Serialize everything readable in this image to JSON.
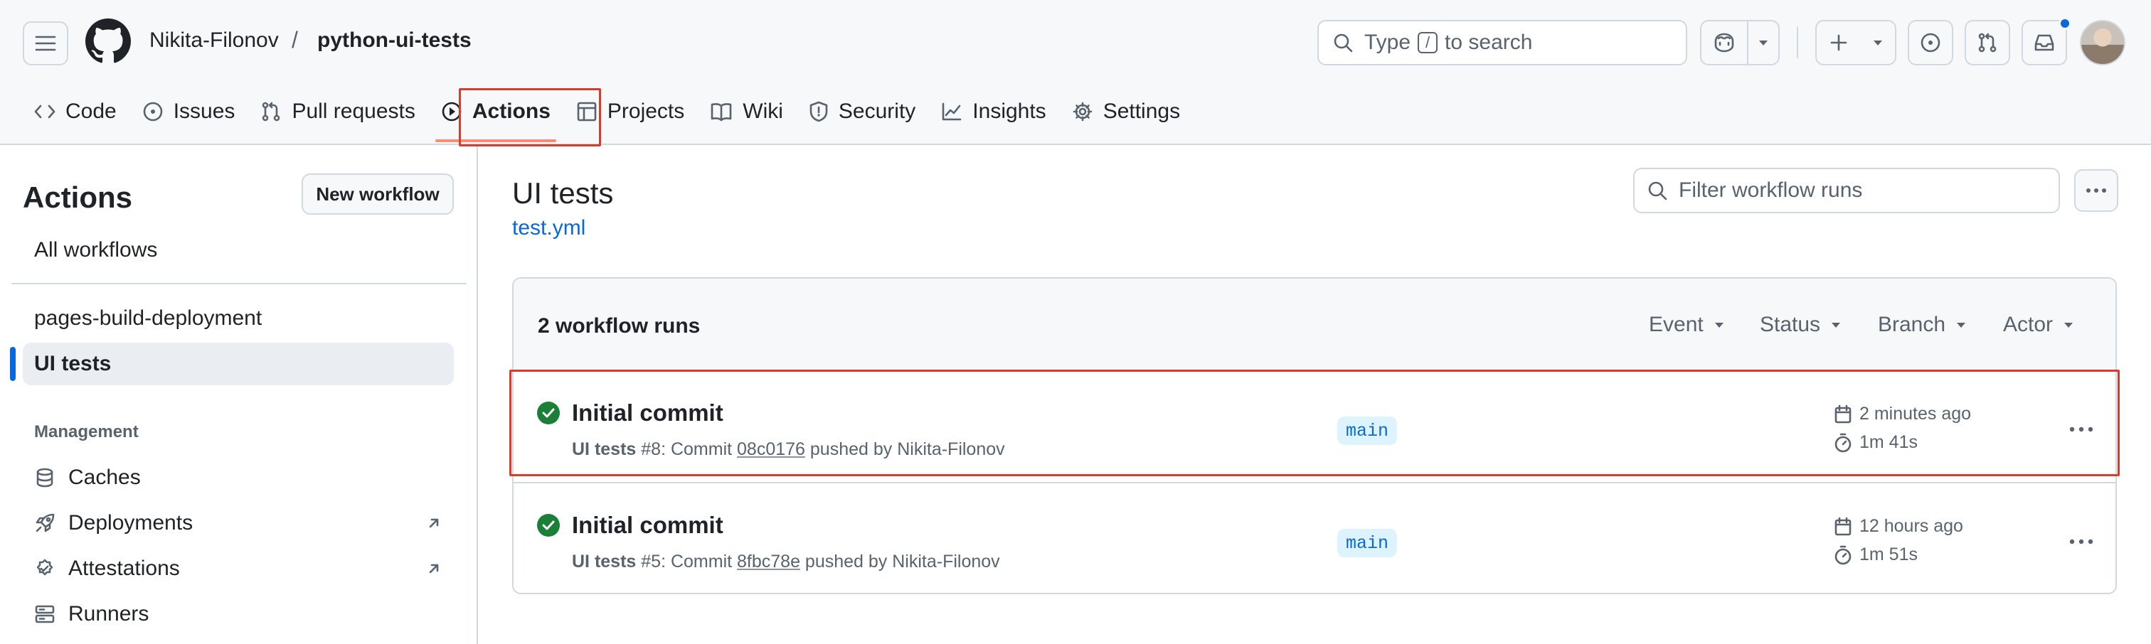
{
  "header": {
    "repo_owner": "Nikita-Filonov",
    "separator": "/",
    "repo_name": "python-ui-tests",
    "search": {
      "prefix": "Type",
      "key": "/",
      "suffix": "to search"
    }
  },
  "tabs": [
    {
      "label": "Code",
      "icon": "code-icon"
    },
    {
      "label": "Issues",
      "icon": "issue-opened-icon"
    },
    {
      "label": "Pull requests",
      "icon": "git-pull-request-icon"
    },
    {
      "label": "Actions",
      "icon": "play-icon",
      "active": true
    },
    {
      "label": "Projects",
      "icon": "table-icon"
    },
    {
      "label": "Wiki",
      "icon": "book-icon"
    },
    {
      "label": "Security",
      "icon": "shield-icon"
    },
    {
      "label": "Insights",
      "icon": "graph-icon"
    },
    {
      "label": "Settings",
      "icon": "gear-icon"
    }
  ],
  "sidebar": {
    "title": "Actions",
    "new_workflow": "New workflow",
    "all_workflows": "All workflows",
    "workflows": [
      "pages-build-deployment",
      "UI tests"
    ],
    "management_heading": "Management",
    "management": [
      {
        "label": "Caches",
        "icon": "database-icon"
      },
      {
        "label": "Deployments",
        "icon": "rocket-icon"
      },
      {
        "label": "Attestations",
        "icon": "verified-icon"
      },
      {
        "label": "Runners",
        "icon": "server-icon"
      }
    ]
  },
  "main": {
    "title": "UI tests",
    "file": "test.yml",
    "filter_placeholder": "Filter workflow runs",
    "runs_count": "2 workflow runs",
    "filters": [
      "Event",
      "Status",
      "Branch",
      "Actor"
    ],
    "runs": [
      {
        "title": "Initial commit",
        "workflow": "UI tests",
        "meta_prefix": " #8: Commit ",
        "sha": "08c0176",
        "meta_suffix": " pushed by Nikita-Filonov",
        "branch": "main",
        "date": "2 minutes ago",
        "duration": "1m 41s",
        "status": "success"
      },
      {
        "title": "Initial commit",
        "workflow": "UI tests",
        "meta_prefix": " #5: Commit ",
        "sha": "8fbc78e",
        "meta_suffix": " pushed by Nikita-Filonov",
        "branch": "main",
        "date": "12 hours ago",
        "duration": "1m 51s",
        "status": "success"
      }
    ]
  },
  "colors": {
    "accent": "#0969da",
    "success": "#1a7f37",
    "highlight": "#d93c2c",
    "tab_underline": "#fd8c73"
  }
}
